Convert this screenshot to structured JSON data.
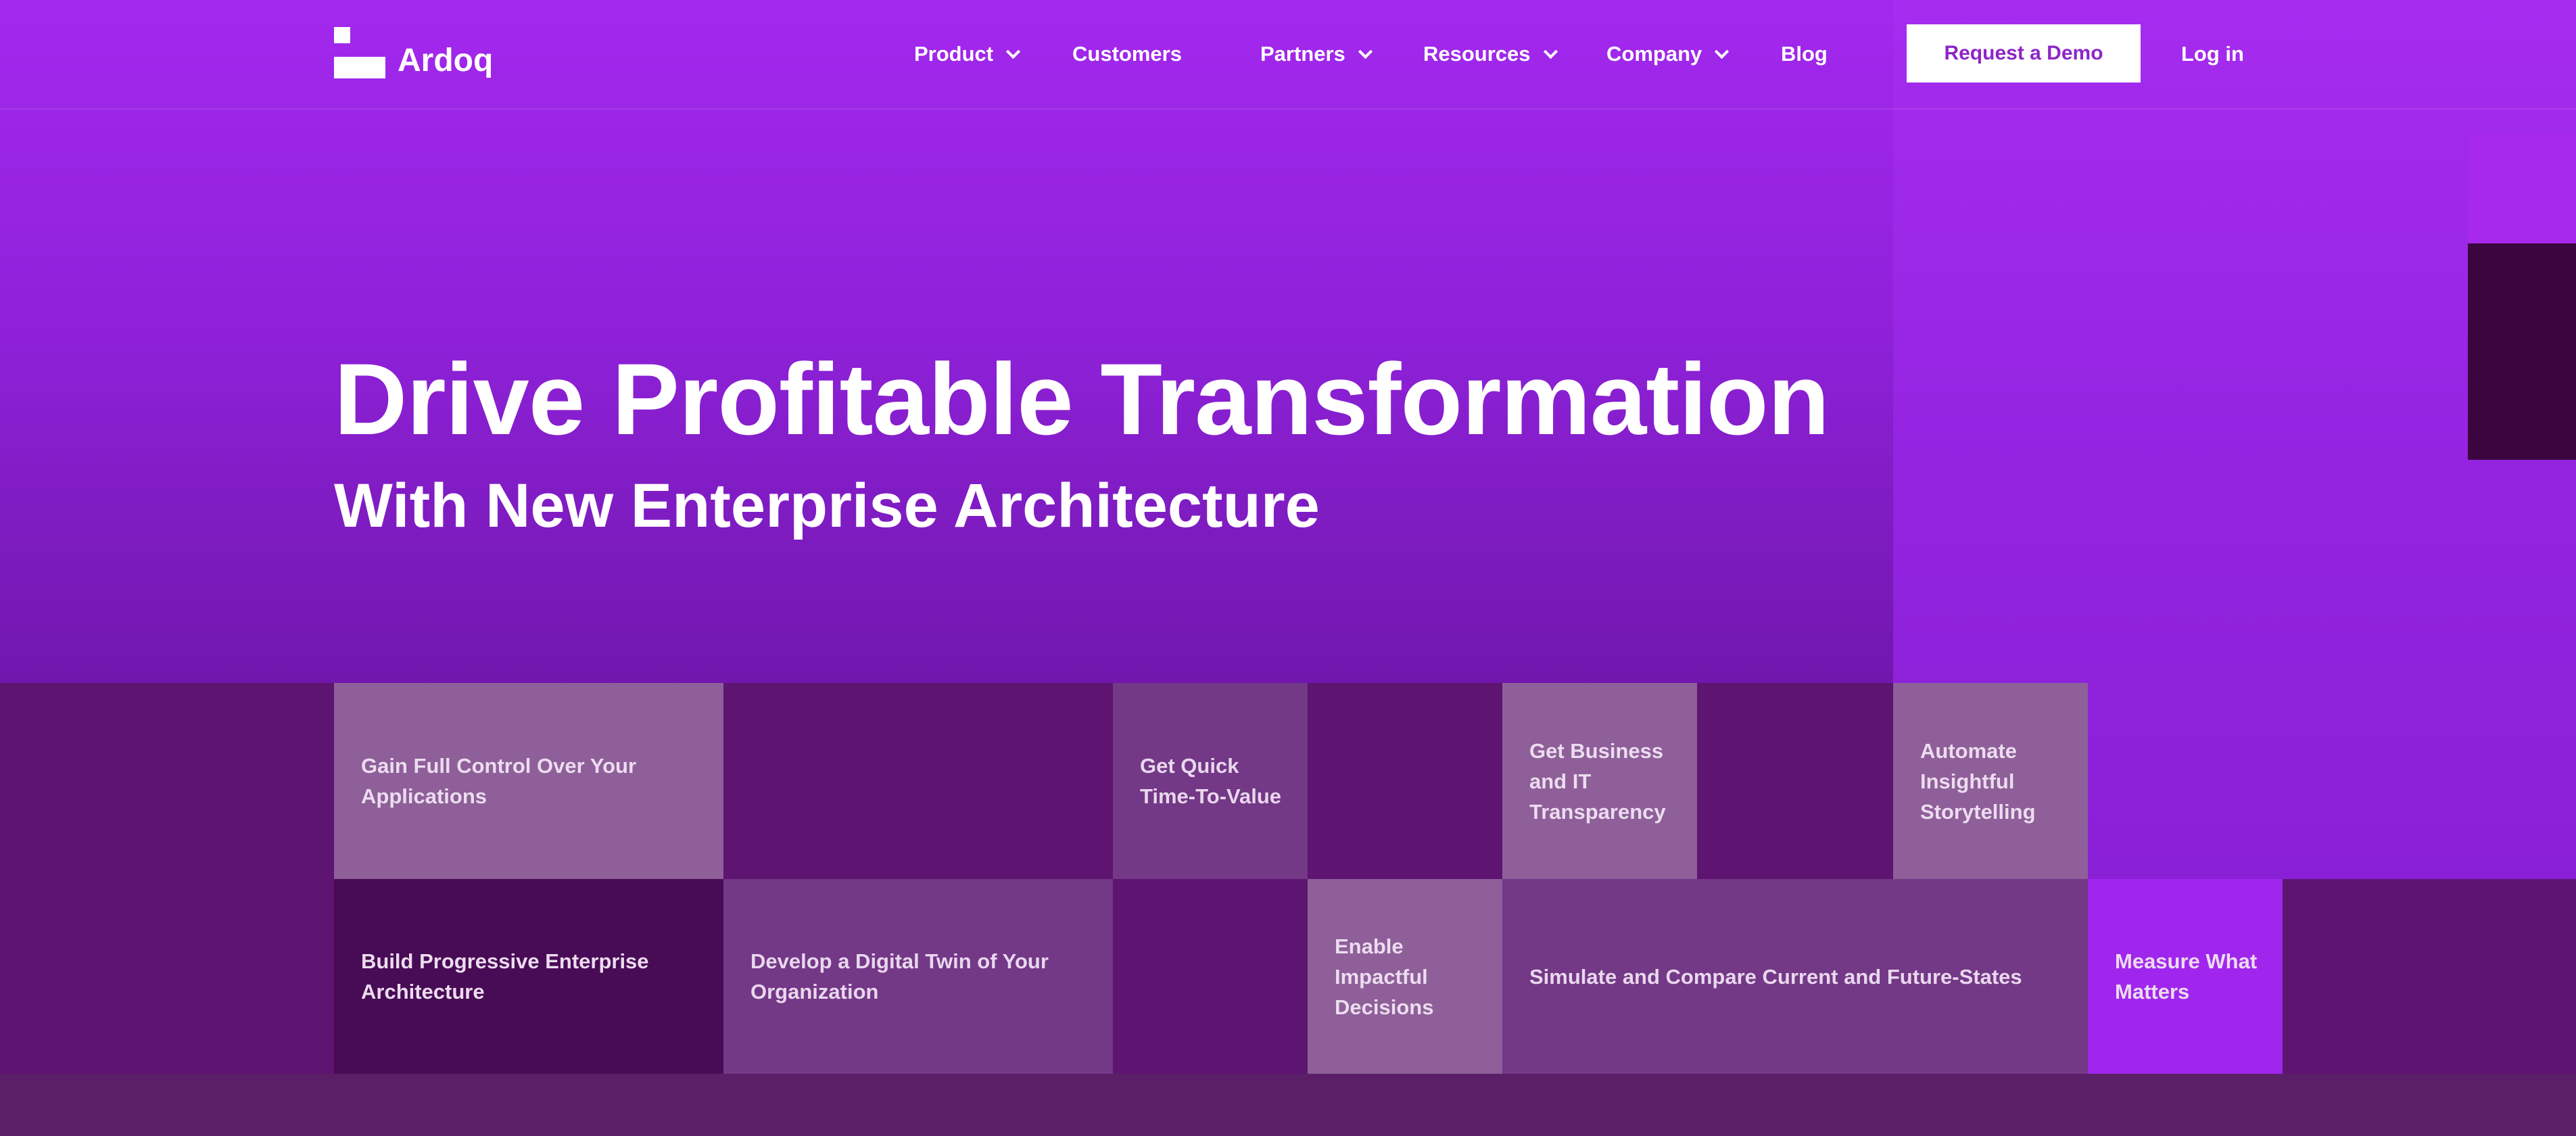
{
  "brand": {
    "name": "Ardoq"
  },
  "nav": {
    "items": [
      {
        "label": "Product",
        "has_dropdown": true
      },
      {
        "label": "Customers",
        "has_dropdown": false
      },
      {
        "label": "Partners",
        "has_dropdown": true
      },
      {
        "label": "Resources",
        "has_dropdown": true
      },
      {
        "label": "Company",
        "has_dropdown": true
      },
      {
        "label": "Blog",
        "has_dropdown": false
      }
    ],
    "cta_label": "Request a Demo",
    "login_label": "Log in"
  },
  "hero": {
    "title": "Drive Profitable Transformation",
    "subtitle": "With New Enterprise Architecture"
  },
  "tiles": {
    "control": "Gain Full Control Over Your Applications",
    "quick": "Get Quick Time-To-Value",
    "transparency": "Get Business and IT Transparency",
    "storytelling": "Automate Insightful Storytelling",
    "progressive": "Build Progressive Enterprise Architecture",
    "twin": "Develop a Digital Twin of Your Organization",
    "decisions": "Enable Impactful Decisions",
    "simulate": "Simulate and Compare Current and Future-States",
    "measure": "Measure What Matters"
  },
  "colors": {
    "brand_purple": "#a328ee",
    "cta_text": "#8d25c8",
    "tile_dark": "#5e1471",
    "tile_light": "#8e5f99",
    "tile_mid": "#733886",
    "tile_bright": "#a026ee"
  }
}
